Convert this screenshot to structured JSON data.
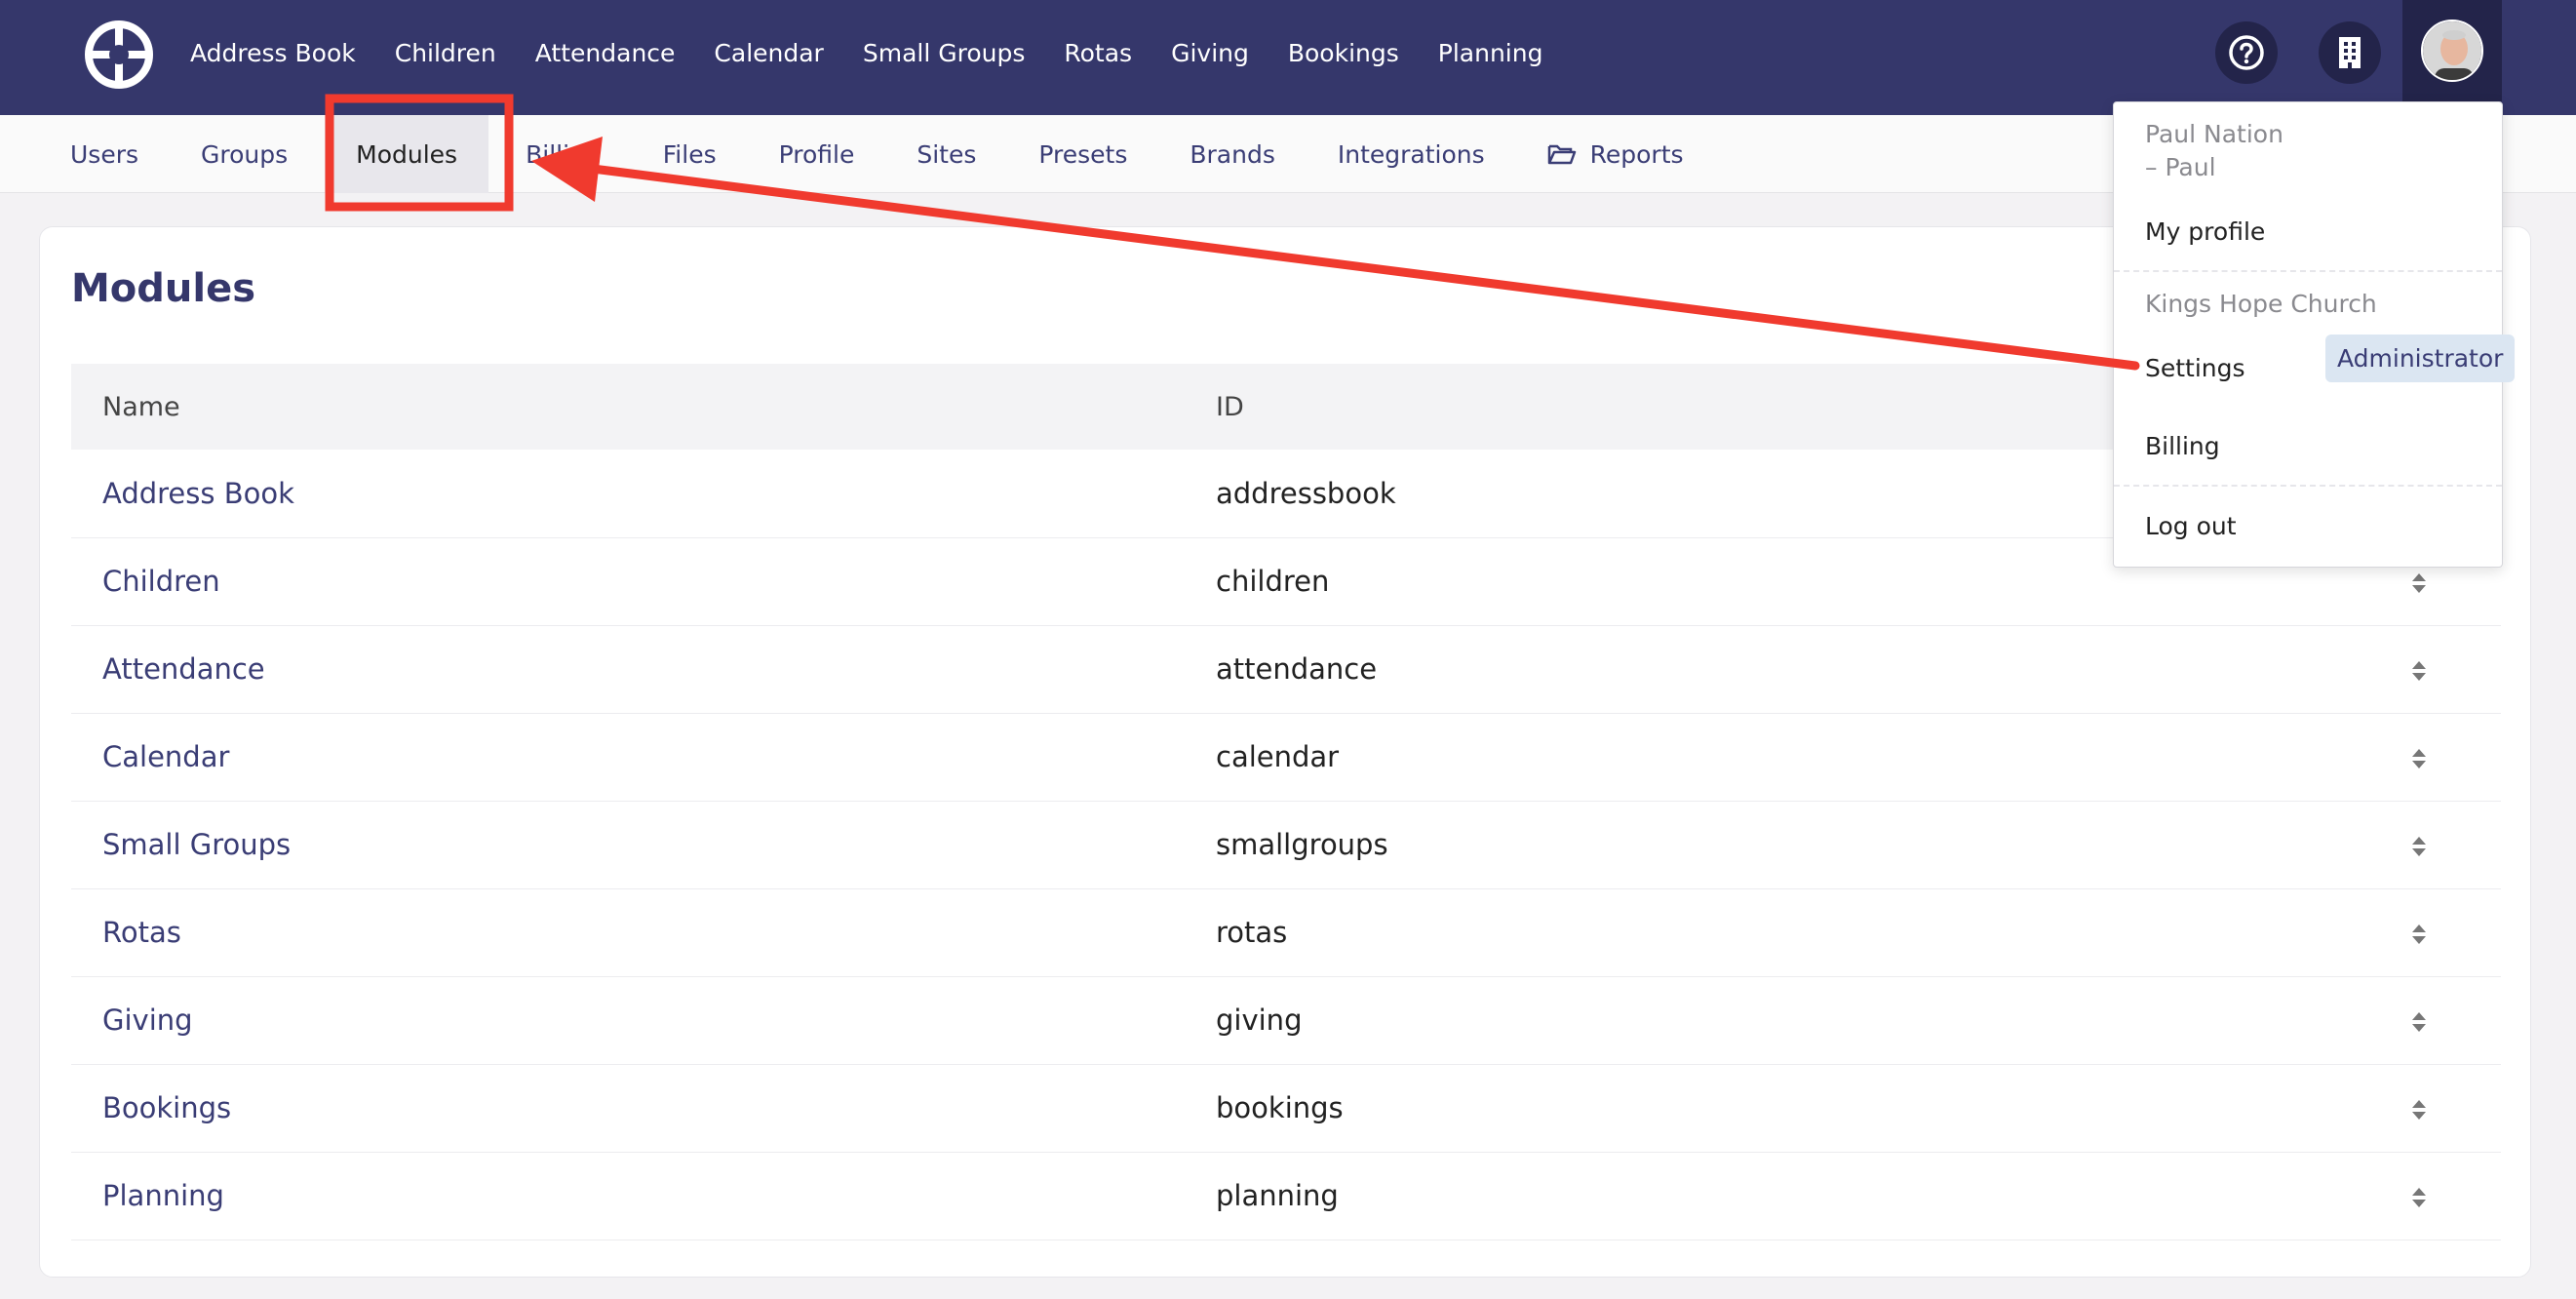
{
  "topnav": {
    "items": [
      {
        "label": "Address Book"
      },
      {
        "label": "Children"
      },
      {
        "label": "Attendance"
      },
      {
        "label": "Calendar"
      },
      {
        "label": "Small Groups"
      },
      {
        "label": "Rotas"
      },
      {
        "label": "Giving"
      },
      {
        "label": "Bookings"
      },
      {
        "label": "Planning"
      }
    ],
    "icons": [
      "help-icon",
      "building-icon"
    ]
  },
  "subnav": {
    "items": [
      {
        "label": "Users"
      },
      {
        "label": "Groups"
      },
      {
        "label": "Modules",
        "active": true
      },
      {
        "label": "Billing"
      },
      {
        "label": "Files"
      },
      {
        "label": "Profile"
      },
      {
        "label": "Sites"
      },
      {
        "label": "Presets"
      },
      {
        "label": "Brands"
      },
      {
        "label": "Integrations"
      },
      {
        "label": "Reports",
        "icon": "folder-open-icon"
      }
    ]
  },
  "page": {
    "title": "Modules",
    "columns": [
      "Name",
      "ID"
    ],
    "rows": [
      {
        "name": "Address Book",
        "id": "addressbook"
      },
      {
        "name": "Children",
        "id": "children"
      },
      {
        "name": "Attendance",
        "id": "attendance"
      },
      {
        "name": "Calendar",
        "id": "calendar"
      },
      {
        "name": "Small Groups",
        "id": "smallgroups"
      },
      {
        "name": "Rotas",
        "id": "rotas"
      },
      {
        "name": "Giving",
        "id": "giving"
      },
      {
        "name": "Bookings",
        "id": "bookings"
      },
      {
        "name": "Planning",
        "id": "planning"
      }
    ]
  },
  "user_menu": {
    "user_name": "Paul Nation",
    "user_short": "– Paul",
    "my_profile": "My profile",
    "church": "Kings Hope Church",
    "settings": "Settings",
    "role_badge": "Administrator",
    "billing": "Billing",
    "logout": "Log out"
  },
  "colors": {
    "brand": "#35376b",
    "annotation": "#f03a2e"
  }
}
